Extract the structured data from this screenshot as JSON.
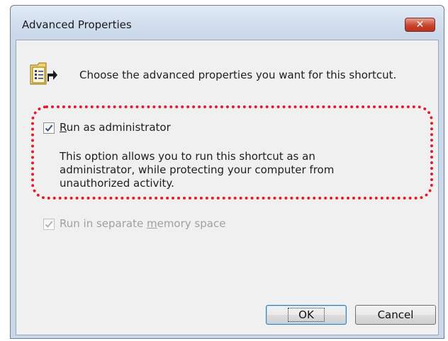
{
  "dialog": {
    "title": "Advanced Properties",
    "close_label": "✕",
    "header_text": "Choose the advanced properties you want for this shortcut."
  },
  "options": {
    "run_as_admin": {
      "label": "Run as administrator",
      "mnemonic": "R",
      "checked": true,
      "enabled": true,
      "description": "This option allows you to run this shortcut as an administrator, while protecting your computer from unauthorized activity."
    },
    "separate_memory": {
      "label": "Run in separate memory space",
      "mnemonic": "m",
      "checked": true,
      "enabled": false
    }
  },
  "buttons": {
    "ok": "OK",
    "cancel": "Cancel"
  },
  "colors": {
    "highlight": "#e8192c",
    "close_button": "#c7442e",
    "check": "#3a4f7a"
  },
  "icons": {
    "header": "shortcut-properties-icon",
    "close": "close-icon"
  }
}
